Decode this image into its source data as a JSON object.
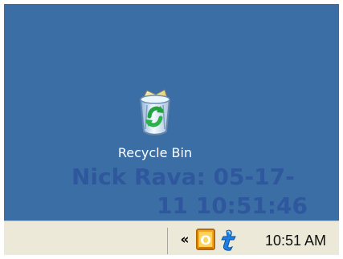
{
  "desktop": {
    "background_color": "#3b6ea5",
    "recycle_bin": {
      "label": "Recycle Bin",
      "icon": "recycle-bin-icon"
    },
    "watermark": {
      "line_1": "Nick Rava: 05-17-",
      "line_2": "11 10:51:46"
    }
  },
  "taskbar": {
    "background_color": "#ece9d8",
    "tray": {
      "chevron_label": "«",
      "chevron_icon": "show-hidden-icons-chevron",
      "icons": [
        "outlook-icon",
        "blue-t-icon"
      ],
      "clock": "10:51 AM"
    }
  }
}
